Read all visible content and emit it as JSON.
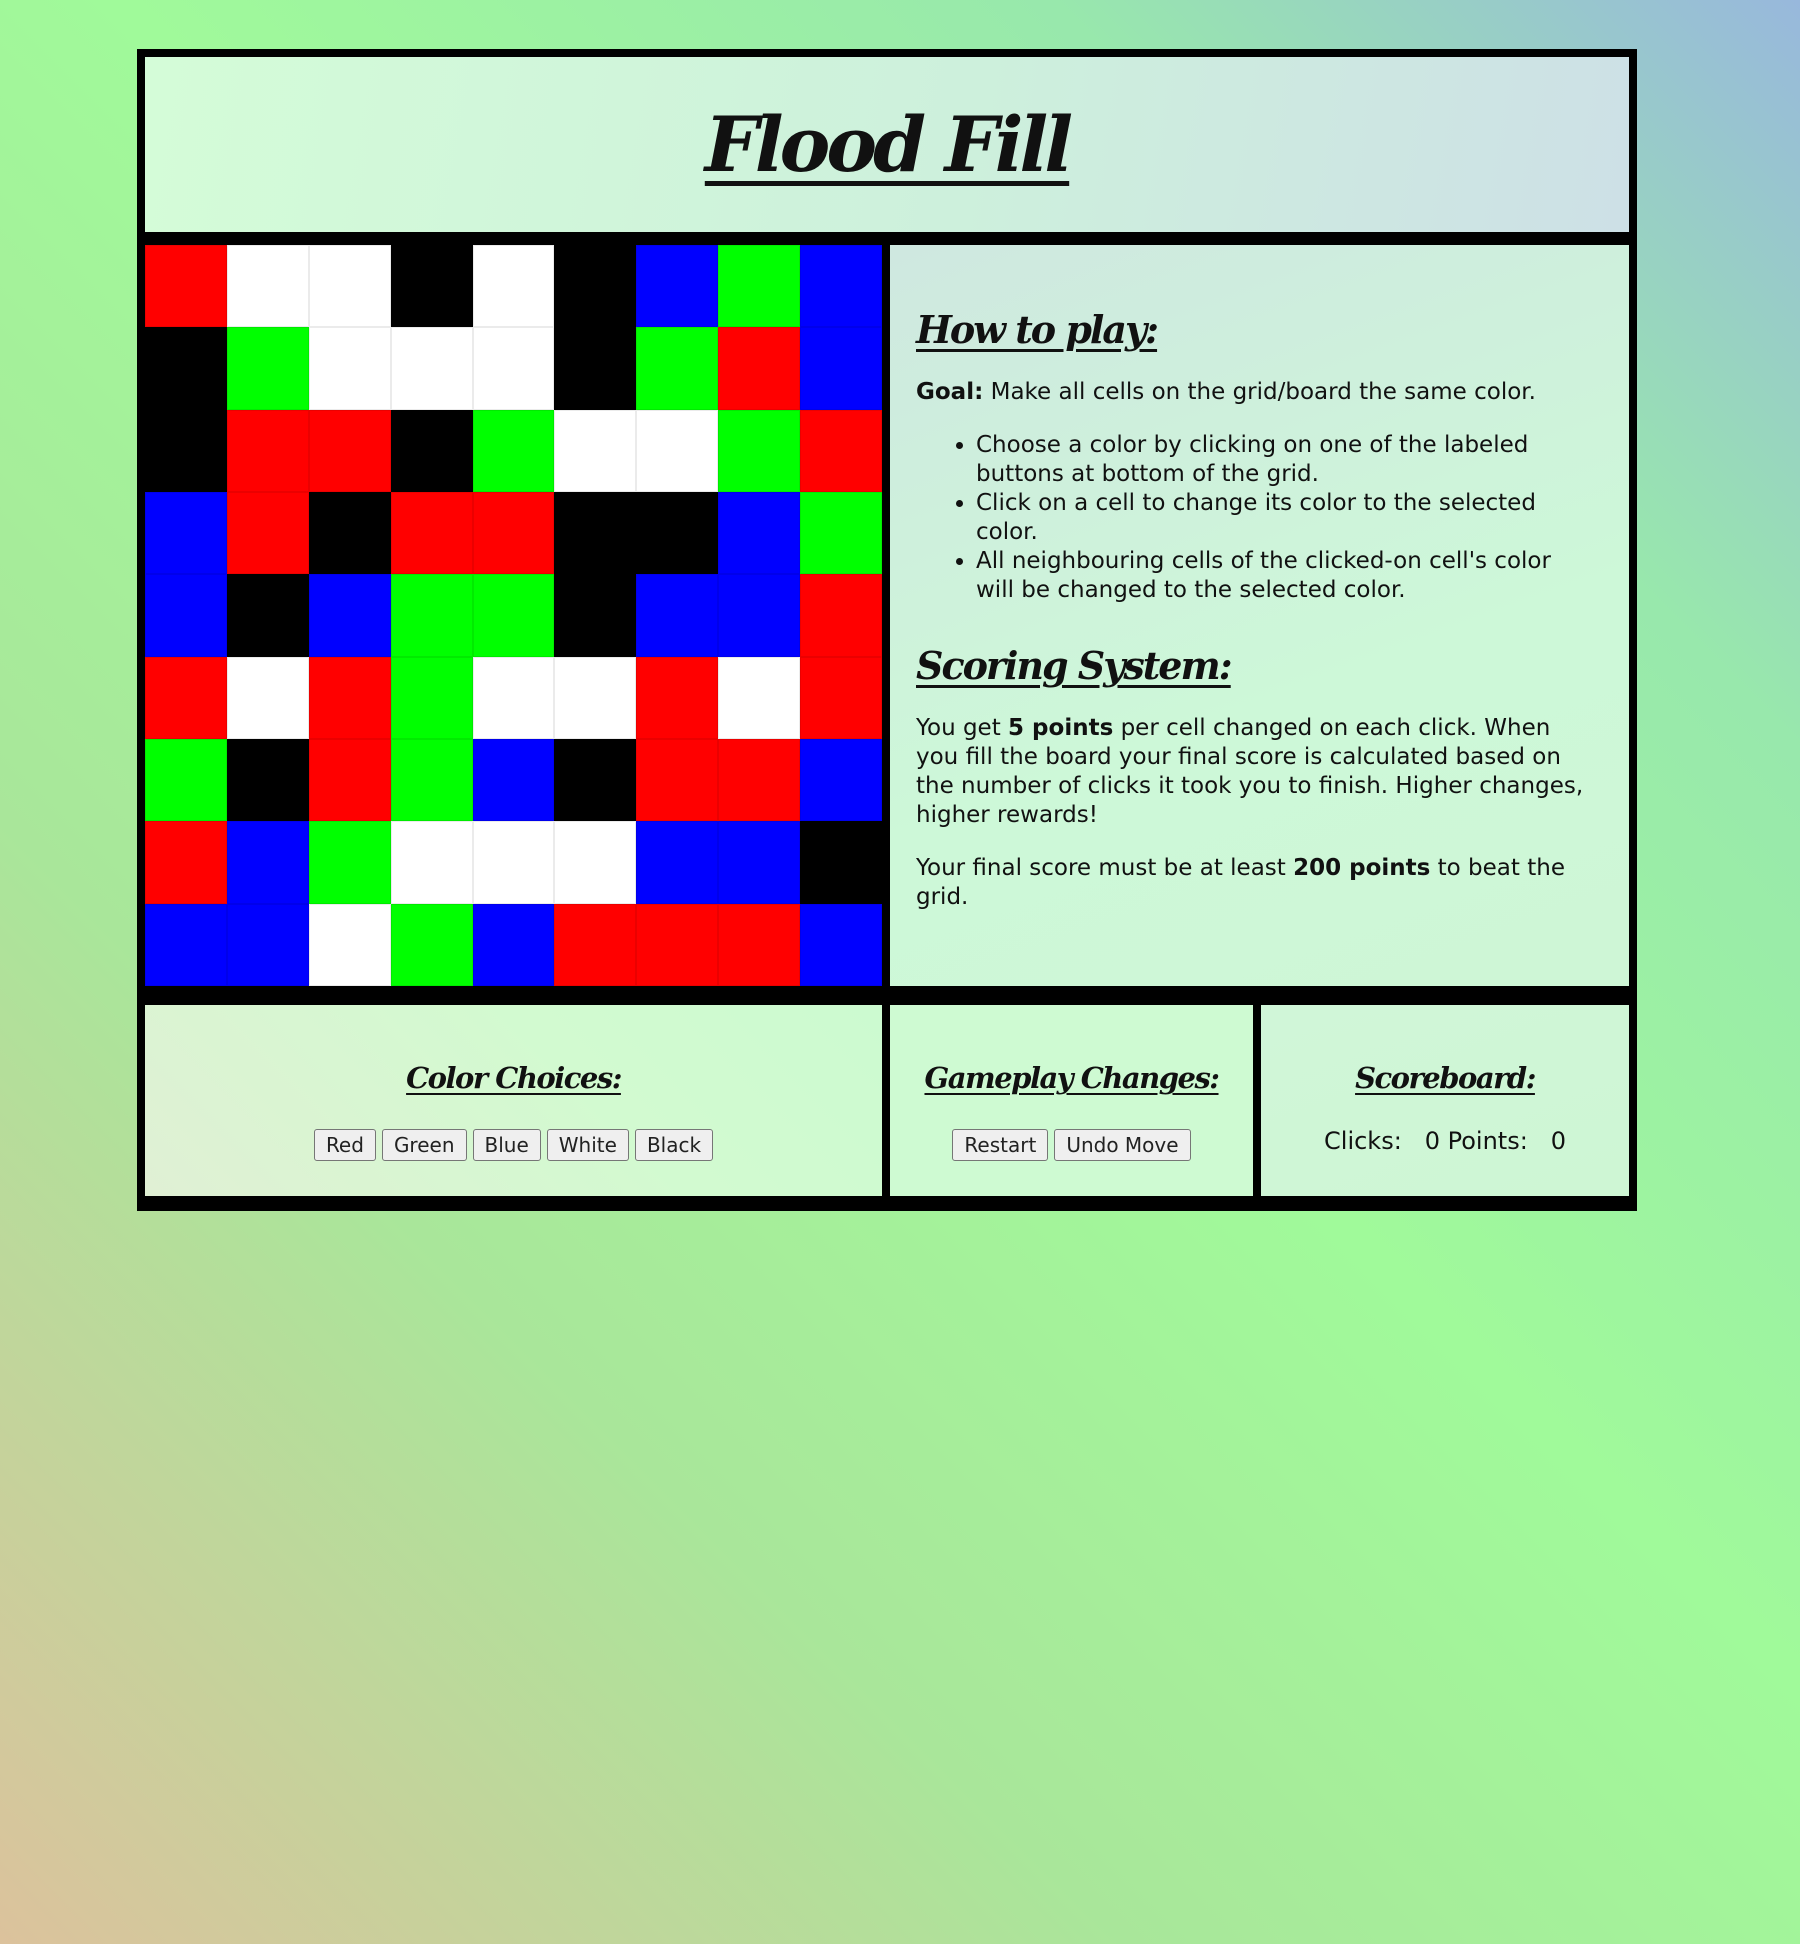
{
  "header": {
    "title": "Flood Fill"
  },
  "colors": {
    "Red": "#ff0000",
    "Green": "#00ff00",
    "Blue": "#0000ff",
    "White": "#ffffff",
    "Black": "#000000"
  },
  "board": {
    "rows": [
      [
        "Red",
        "White",
        "White",
        "Black",
        "White",
        "Black",
        "Blue",
        "Green",
        "Blue"
      ],
      [
        "Black",
        "Green",
        "White",
        "White",
        "White",
        "Black",
        "Green",
        "Red",
        "Blue"
      ],
      [
        "Black",
        "Red",
        "Red",
        "Black",
        "Green",
        "White",
        "White",
        "Green",
        "Red"
      ],
      [
        "Blue",
        "Red",
        "Black",
        "Red",
        "Red",
        "Black",
        "Black",
        "Blue",
        "Green"
      ],
      [
        "Blue",
        "Black",
        "Blue",
        "Green",
        "Green",
        "Black",
        "Blue",
        "Blue",
        "Red"
      ],
      [
        "Red",
        "White",
        "Red",
        "Green",
        "White",
        "White",
        "Red",
        "White",
        "Red"
      ],
      [
        "Green",
        "Black",
        "Red",
        "Green",
        "Blue",
        "Black",
        "Red",
        "Red",
        "Blue"
      ],
      [
        "Red",
        "Blue",
        "Green",
        "White",
        "White",
        "White",
        "Blue",
        "Blue",
        "Black"
      ],
      [
        "Blue",
        "Blue",
        "White",
        "Green",
        "Blue",
        "Red",
        "Red",
        "Red",
        "Blue"
      ]
    ]
  },
  "instructions": {
    "how_to_play_heading": "How to play:",
    "goal_label": "Goal:",
    "goal_text": " Make all cells on the grid/board the same color.",
    "rules": [
      "Choose a color by clicking on one of the labeled buttons at bottom of the grid.",
      "Click on a cell to change its color to the selected color.",
      "All neighbouring cells of the clicked-on cell's color will be changed to the selected color."
    ],
    "scoring_heading": "Scoring System:",
    "score_p1_before": "You get ",
    "score_p1_bold": "5 points",
    "score_p1_after": " per cell changed on each click. When you fill the board your final score is calculated based on the number of clicks it took you to finish. Higher changes, higher rewards!",
    "score_p2_before": "Your final score must be at least ",
    "score_p2_bold": "200 points",
    "score_p2_after": " to beat the grid."
  },
  "color_choices": {
    "heading": "Color Choices:",
    "buttons": [
      "Red",
      "Green",
      "Blue",
      "White",
      "Black"
    ]
  },
  "gameplay": {
    "heading": "Gameplay Changes:",
    "restart_label": "Restart",
    "undo_label": "Undo Move"
  },
  "scoreboard": {
    "heading": "Scoreboard:",
    "clicks_label": "Clicks:",
    "clicks_value": "0",
    "points_label": "Points:",
    "points_value": "0"
  }
}
